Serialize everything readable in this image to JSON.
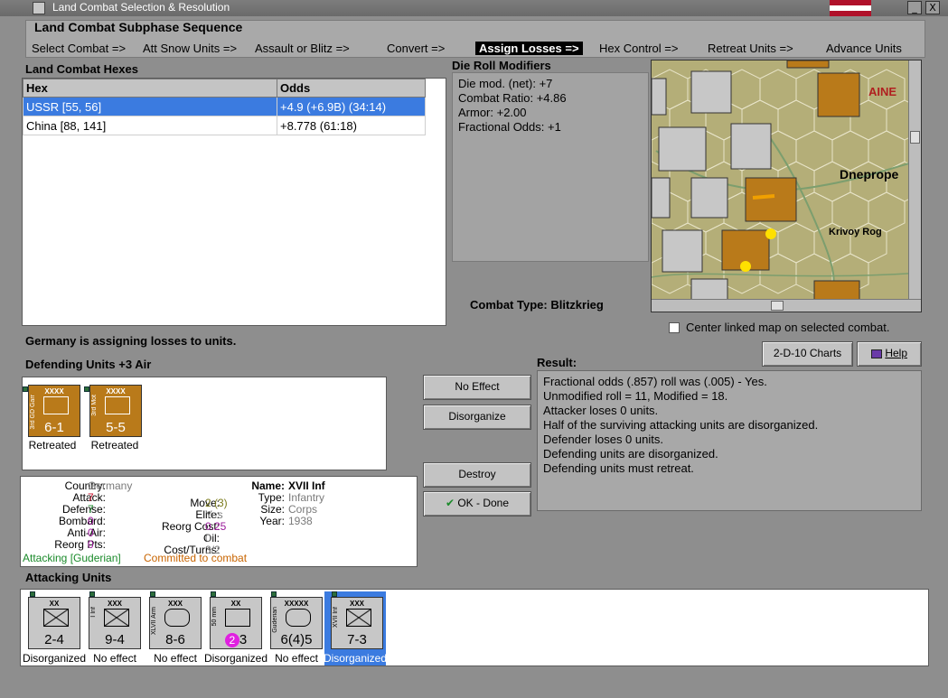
{
  "window": {
    "title": "Land Combat Selection & Resolution",
    "min": "_",
    "close": "X"
  },
  "sequence": {
    "title": "Land Combat Subphase Sequence",
    "steps": [
      "Select Combat =>",
      "Att Snow Units =>",
      "Assault or Blitz =>",
      "Convert =>",
      "Assign Losses =>",
      "Hex Control =>",
      "Retreat Units =>",
      "Advance Units"
    ],
    "active_index": 4
  },
  "hexes": {
    "title": "Land Combat Hexes",
    "col_hex": "Hex",
    "col_odds": "Odds",
    "rows": [
      {
        "hex": "USSR [55, 56]",
        "odds": "+4.9 (+6.9B) (34:14)",
        "selected": true
      },
      {
        "hex": "China [88, 141]",
        "odds": "+8.778 (61:18)",
        "selected": false
      }
    ]
  },
  "modifiers": {
    "title": "Die Roll Modifiers",
    "lines": [
      "Die mod. (net): +7",
      "",
      "Combat Ratio: +4.86",
      "Armor: +2.00",
      "Fractional Odds: +1"
    ]
  },
  "combat_type": {
    "label": "Combat Type:",
    "value": "Blitzkrieg"
  },
  "map": {
    "labels": [
      "AINE",
      "Dneprope",
      "Krivoy Rog"
    ],
    "center_linked_label": "Center linked map on selected combat."
  },
  "status_message": "Germany is assigning losses to units.",
  "defending": {
    "title": "Defending Units +3 Air",
    "units": [
      {
        "size": "XXXX",
        "name": "3rd GD Garr",
        "strength": "6-1",
        "status": "Retreated"
      },
      {
        "size": "XXXX",
        "name": "3rd Mot",
        "strength": "5-5",
        "status": "Retreated"
      }
    ]
  },
  "buttons": {
    "no_effect": "No Effect",
    "disorganize": "Disorganize",
    "destroy": "Destroy",
    "ok_done": "OK - Done",
    "charts": "2-D-10 Charts",
    "help": "Help"
  },
  "result": {
    "title": "Result:",
    "lines": [
      "Fractional odds (.857) roll was (.005)  - Yes.",
      "Unmodified roll = 11, Modified = 18.",
      "Attacker loses 0 units.",
      "Half of the surviving attacking units are disorganized.",
      "Defender loses 0 units.",
      "Defending units are disorganized.",
      "Defending units must retreat."
    ]
  },
  "unit_info": {
    "country_label": "Country:",
    "country": "Germany",
    "attack_label": "Attack:",
    "attack": "7",
    "defense_label": "Defense:",
    "defense": "7",
    "bombard_label": "Bombard:",
    "bombard": "0",
    "antiair_label": "Anti-Air:",
    "antiair": "0",
    "reorg_pts_label": "Reorg Pts:",
    "reorg_pts": "0",
    "name_label": "Name:",
    "name": "XVII Inf",
    "move_label": "Move:",
    "move": "2 (3)",
    "elite_label": "Elite:",
    "elite": "Yes",
    "reorg_cost_label": "Reorg Cost:",
    "reorg_cost": "0.25",
    "oil_label": "Oil:",
    "oil": "0",
    "cost_turns_label": "Cost/Turns:",
    "cost_turns": "3/2",
    "type_label": "Type:",
    "type": "Infantry",
    "size_label": "Size:",
    "size": "Corps",
    "year_label": "Year:",
    "year": "1938",
    "attacking_text": "Attacking [Guderian]",
    "committed_text": "Committed to combat"
  },
  "attacking": {
    "title": "Attacking Units",
    "units": [
      {
        "size": "XX",
        "name": "",
        "strength": "2-4",
        "status": "Disorganized"
      },
      {
        "size": "XXX",
        "name": "I Inf",
        "strength": "9-4",
        "status": "No effect"
      },
      {
        "size": "XXX",
        "name": "XLVII Arm",
        "strength": "8-6",
        "status": "No effect"
      },
      {
        "size": "XX",
        "name": "50 mm",
        "strength": "3",
        "badge": "2",
        "status": "Disorganized"
      },
      {
        "size": "XXXXX",
        "name": "Guderian",
        "strength": "6(4)5",
        "status": "No effect"
      },
      {
        "size": "XXX",
        "name": "XVII Inf",
        "strength": "7-3",
        "status": "Disorganized",
        "selected": true
      }
    ]
  },
  "colors": {
    "selected_row": "#3b7be0",
    "gold_unit": "#b97a1a",
    "grey_unit": "#c7c7c7",
    "red_value": "#c8102e",
    "green_value": "#1a8a2a",
    "purple_value": "#9a1a9a",
    "orange_value": "#c86400",
    "grey_value": "#7a7a7a"
  }
}
